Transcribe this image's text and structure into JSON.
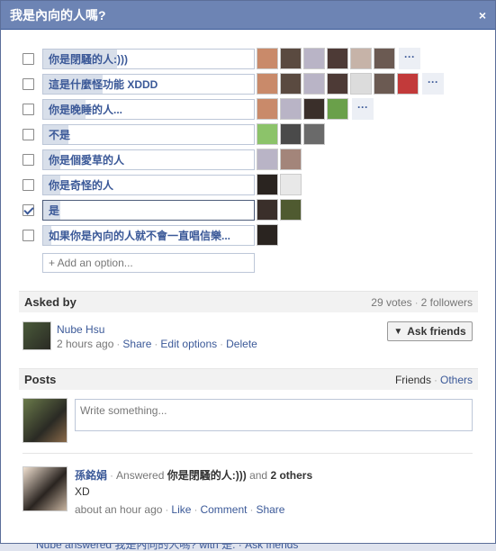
{
  "dialog": {
    "title": "我是內向的人嗎?",
    "close_glyph": "×"
  },
  "options": [
    {
      "label": "你是閉騷的人:)))",
      "fill_fraction": 0.35,
      "checked": false,
      "voters": [
        "#c98a6a",
        "#5a4a40",
        "#b9b4c6",
        "#4d3a36",
        "#c6b3a8",
        "#6b5a52"
      ],
      "more": true
    },
    {
      "label": "這是什麼怪功能 XDDD",
      "fill_fraction": 0.28,
      "checked": false,
      "voters": [
        "#c98a6a",
        "#5a4a40",
        "#b9b4c6",
        "#4d3a36",
        "#dcdcdc",
        "#6b5a52",
        "#c23a3a"
      ],
      "more": true
    },
    {
      "label": "你是晚睡的人...",
      "fill_fraction": 0.2,
      "checked": false,
      "voters": [
        "#c98a6a",
        "#b9b4c6",
        "#3a2f2a",
        "#6aa04a"
      ],
      "more": true
    },
    {
      "label": "不是",
      "fill_fraction": 0.12,
      "checked": false,
      "voters": [
        "#8cc36a",
        "#4a4a4a",
        "#6a6a6a"
      ],
      "more": false
    },
    {
      "label": "你是個愛草的人",
      "fill_fraction": 0.08,
      "checked": false,
      "voters": [
        "#b9b4c6",
        "#a3857a"
      ],
      "more": false
    },
    {
      "label": "你是奇怪的人",
      "fill_fraction": 0.08,
      "checked": false,
      "voters": [
        "#2a2420",
        "#e8e8e8"
      ],
      "more": false
    },
    {
      "label": "是",
      "fill_fraction": 0.08,
      "checked": true,
      "voters": [
        "#3a2f2a",
        "#4f5a30"
      ],
      "more": false
    },
    {
      "label": "如果你是內向的人就不會一直唱信樂...",
      "fill_fraction": 0.04,
      "checked": false,
      "voters": [
        "#2a2420"
      ],
      "more": false
    }
  ],
  "add_option": {
    "label": "+ Add an option..."
  },
  "asked_by": {
    "heading": "Asked by",
    "votes": "29 votes",
    "followers": "2 followers",
    "name": "Nube Hsu",
    "time": "2 hours ago",
    "share": "Share",
    "edit": "Edit options",
    "delete": "Delete",
    "ask_friends": "Ask friends"
  },
  "posts": {
    "heading": "Posts",
    "filter_friends": "Friends",
    "filter_others": "Others",
    "composer_placeholder": "Write something...",
    "items": [
      {
        "author": "孫銘娟",
        "action": "Answered",
        "answer": "你是閉騷的人:)))",
        "and_text": "and",
        "others": "2 others",
        "text": "XD",
        "time": "about an hour ago",
        "like": "Like",
        "comment": "Comment",
        "share": "Share"
      }
    ]
  },
  "background_text": "Nube answered 我是內向的人嗎? with 是. · Ask friends",
  "colors": {
    "header_blue": "#6d84b4",
    "link_blue": "#3b5998",
    "bar_fill": "#d8dfea"
  }
}
